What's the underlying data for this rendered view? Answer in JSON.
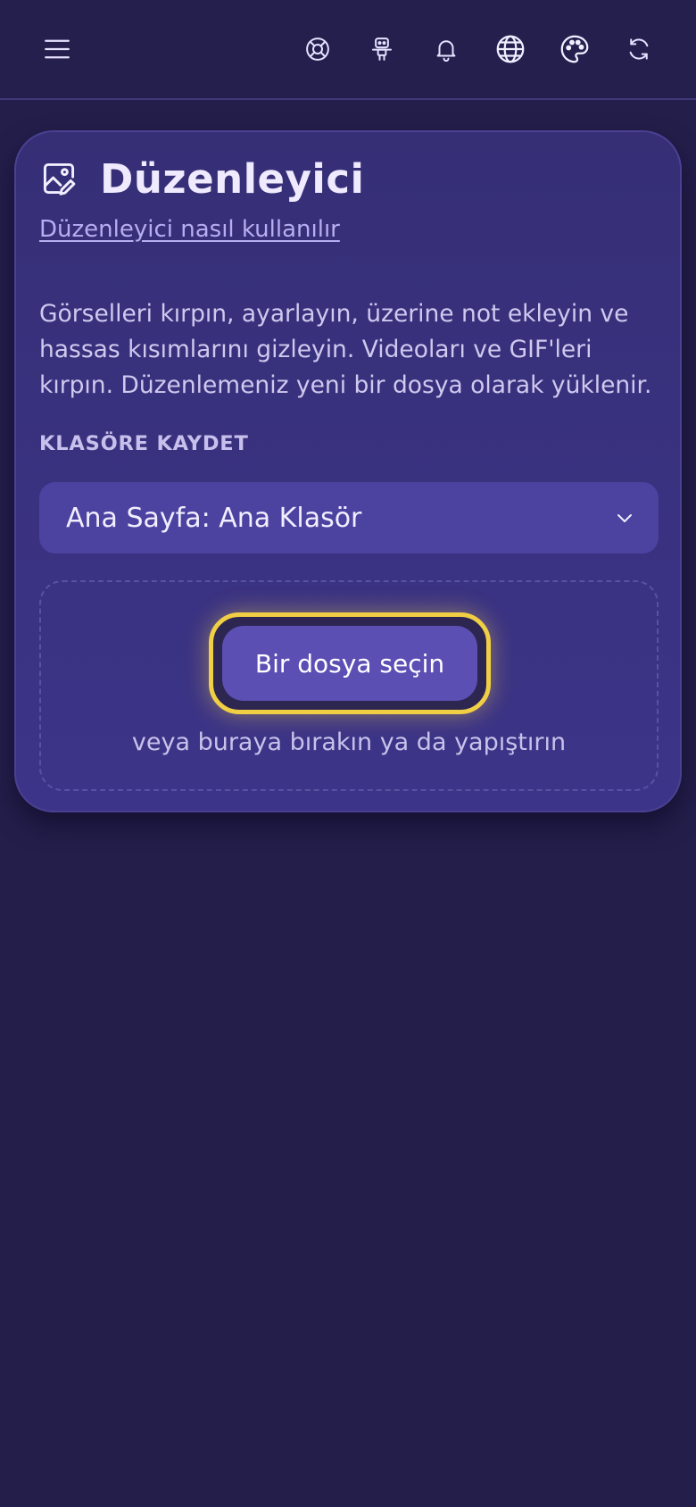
{
  "topbar": {
    "icons": [
      "menu-icon",
      "lifebuoy-icon",
      "robot-icon",
      "bell-icon",
      "globe-icon",
      "palette-icon",
      "refresh-icon"
    ]
  },
  "card": {
    "icon": "image-edit-icon",
    "title": "Düzenleyici",
    "howto_link": "Düzenleyici nasıl kullanılır",
    "description": "Görselleri kırpın, ayarlayın, üzerine not ekleyin ve hassas kısımlarını gizleyin. Videoları ve GIF'leri kırpın. Düzenlemeniz yeni bir dosya olarak yüklenir.",
    "save_folder_label": "KLASÖRE KAYDET",
    "folder_select": {
      "value": "Ana Sayfa: Ana Klasör"
    },
    "dropzone": {
      "button_label": "Bir dosya seçin",
      "hint": "veya buraya bırakın ya da yapıştırın"
    }
  },
  "colors": {
    "background": "#241e4b",
    "card": "#3a3284",
    "accent_focus": "#f1cf44",
    "button": "#5b4fb4",
    "link": "#b6aef0"
  }
}
